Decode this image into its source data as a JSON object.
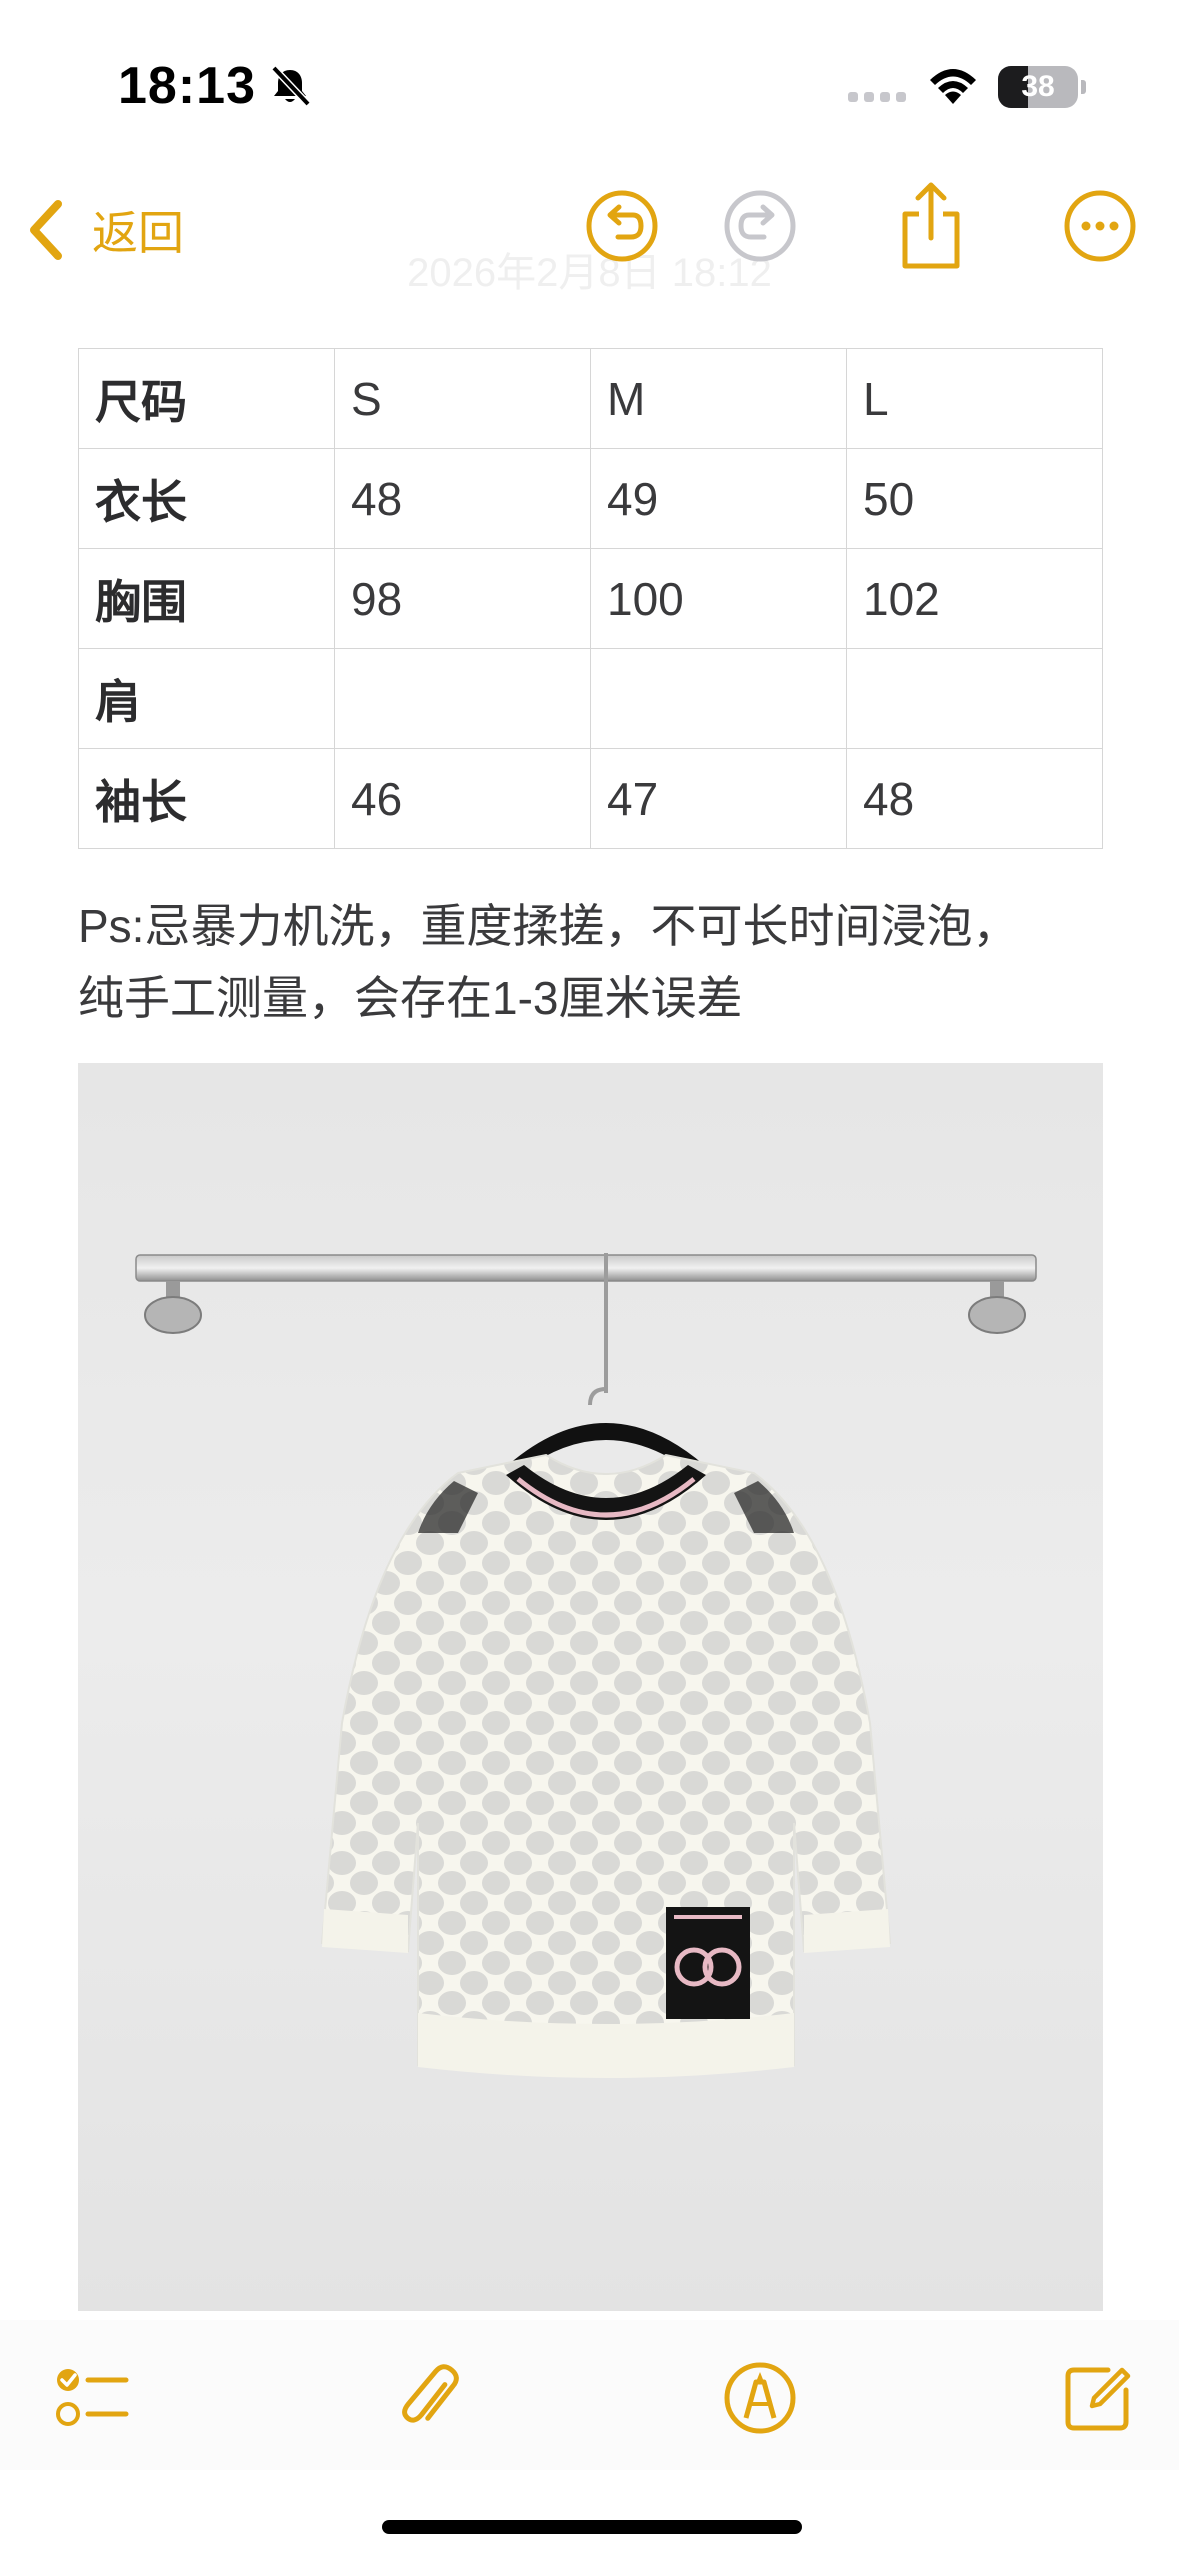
{
  "status_bar": {
    "time": "18:13",
    "battery_level": "38",
    "battery_fraction": 0.38
  },
  "nav": {
    "back_label": "返回",
    "date_text": "2026年2月8日 18:12",
    "icons": [
      "chevron-left-icon",
      "undo-icon",
      "redo-icon",
      "share-icon",
      "more-icon"
    ]
  },
  "size_table": {
    "rows": [
      [
        "尺码",
        "S",
        "M",
        "L"
      ],
      [
        "衣长",
        "48",
        "49",
        "50"
      ],
      [
        "胸围",
        "98",
        "100",
        "102"
      ],
      [
        "肩",
        "",
        "",
        ""
      ],
      [
        "袖长",
        "46",
        "47",
        "48"
      ]
    ]
  },
  "note": {
    "line1": "Ps:忌暴力机洗，重度揉搓，不可长时间浸泡，",
    "line2": "纯手工测量，会存在1-3厘米误差"
  },
  "toolbar": {
    "icons": [
      "checklist-icon",
      "paperclip-icon",
      "markup-pen-icon",
      "compose-icon"
    ]
  },
  "colors": {
    "accent": "#e2a511",
    "disabled": "#c7c7cc",
    "text": "#3a3a3c"
  }
}
